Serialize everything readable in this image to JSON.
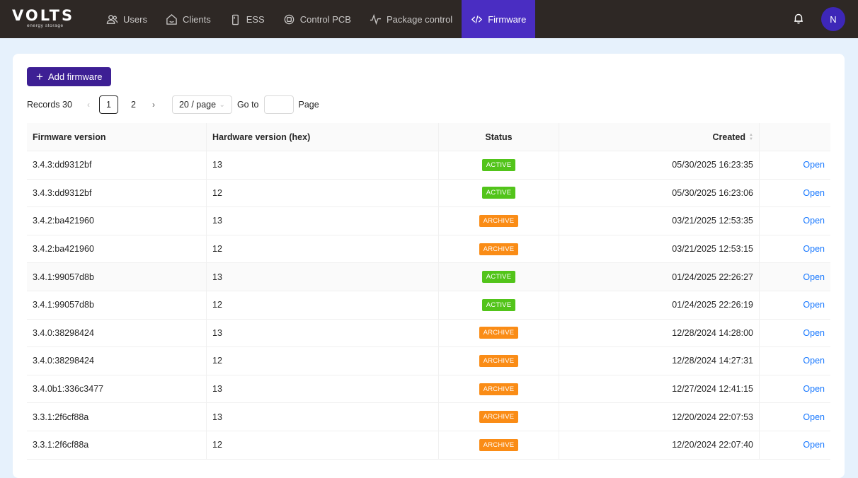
{
  "brand": {
    "name": "VOLTS",
    "tagline": "energy storage"
  },
  "nav": [
    {
      "label": "Users",
      "icon": "users-icon",
      "active": false
    },
    {
      "label": "Clients",
      "icon": "clients-icon",
      "active": false
    },
    {
      "label": "ESS",
      "icon": "battery-icon",
      "active": false
    },
    {
      "label": "Control PCB",
      "icon": "chip-icon",
      "active": false
    },
    {
      "label": "Package control",
      "icon": "pulse-icon",
      "active": false
    },
    {
      "label": "Firmware",
      "icon": "code-icon",
      "active": true
    }
  ],
  "header": {
    "avatar_initial": "N",
    "bell_icon": "bell-icon"
  },
  "toolbar": {
    "add_label": "Add firmware"
  },
  "pagination": {
    "records_label": "Records 30",
    "pages": [
      "1",
      "2"
    ],
    "current_page": "1",
    "page_size": "20 / page",
    "goto_label": "Go to",
    "goto_value": "",
    "page_label": "Page"
  },
  "table": {
    "columns": [
      "Firmware version",
      "Hardware version (hex)",
      "Status",
      "Created",
      ""
    ],
    "rows": [
      {
        "firmware": "3.4.3:dd9312bf",
        "hardware": "13",
        "status": "ACTIVE",
        "created": "05/30/2025 16:23:35",
        "action": "Open"
      },
      {
        "firmware": "3.4.3:dd9312bf",
        "hardware": "12",
        "status": "ACTIVE",
        "created": "05/30/2025 16:23:06",
        "action": "Open"
      },
      {
        "firmware": "3.4.2:ba421960",
        "hardware": "13",
        "status": "ARCHIVE",
        "created": "03/21/2025 12:53:35",
        "action": "Open"
      },
      {
        "firmware": "3.4.2:ba421960",
        "hardware": "12",
        "status": "ARCHIVE",
        "created": "03/21/2025 12:53:15",
        "action": "Open"
      },
      {
        "firmware": "3.4.1:99057d8b",
        "hardware": "13",
        "status": "ACTIVE",
        "created": "01/24/2025 22:26:27",
        "action": "Open"
      },
      {
        "firmware": "3.4.1:99057d8b",
        "hardware": "12",
        "status": "ACTIVE",
        "created": "01/24/2025 22:26:19",
        "action": "Open"
      },
      {
        "firmware": "3.4.0:38298424",
        "hardware": "13",
        "status": "ARCHIVE",
        "created": "12/28/2024 14:28:00",
        "action": "Open"
      },
      {
        "firmware": "3.4.0:38298424",
        "hardware": "12",
        "status": "ARCHIVE",
        "created": "12/28/2024 14:27:31",
        "action": "Open"
      },
      {
        "firmware": "3.4.0b1:336c3477",
        "hardware": "13",
        "status": "ARCHIVE",
        "created": "12/27/2024 12:41:15",
        "action": "Open"
      },
      {
        "firmware": "3.3.1:2f6cf88a",
        "hardware": "13",
        "status": "ARCHIVE",
        "created": "12/20/2024 22:07:53",
        "action": "Open"
      },
      {
        "firmware": "3.3.1:2f6cf88a",
        "hardware": "12",
        "status": "ARCHIVE",
        "created": "12/20/2024 22:07:40",
        "action": "Open"
      }
    ]
  },
  "colors": {
    "topbar": "#2e2825",
    "nav_active": "#4a2dc2",
    "primary_button": "#3d1f94",
    "status_active": "#52c41a",
    "status_archive": "#fa8c16",
    "link": "#1677ff"
  }
}
